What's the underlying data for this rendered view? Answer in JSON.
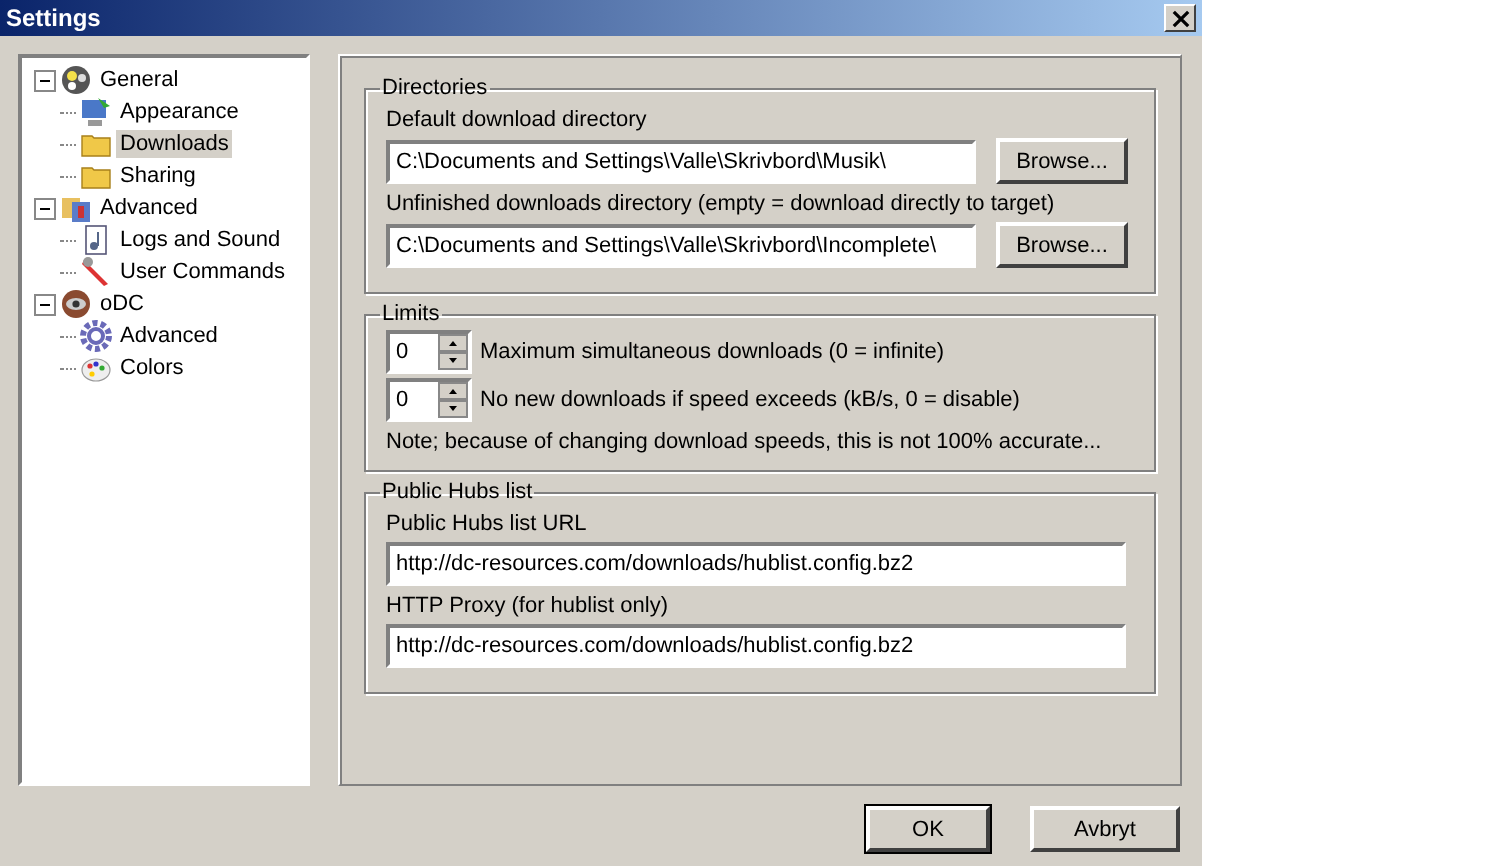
{
  "window": {
    "title": "Settings"
  },
  "tree": [
    {
      "label": "General",
      "expanded": true,
      "selected": false,
      "children": [
        {
          "label": "Appearance",
          "selected": false
        },
        {
          "label": "Downloads",
          "selected": true
        },
        {
          "label": "Sharing",
          "selected": false
        }
      ]
    },
    {
      "label": "Advanced",
      "expanded": true,
      "selected": false,
      "children": [
        {
          "label": "Logs and Sound",
          "selected": false
        },
        {
          "label": "User Commands",
          "selected": false
        }
      ]
    },
    {
      "label": "oDC",
      "expanded": true,
      "selected": false,
      "children": [
        {
          "label": "Advanced",
          "selected": false
        },
        {
          "label": "Colors",
          "selected": false
        }
      ]
    }
  ],
  "directories": {
    "title": "Directories",
    "fields": [
      {
        "label": "Default download directory",
        "value": "C:\\Documents and Settings\\Valle\\Skrivbord\\Musik\\",
        "button": "Browse..."
      },
      {
        "label": "Unfinished downloads directory (empty = download directly to target)",
        "value": "C:\\Documents and Settings\\Valle\\Skrivbord\\Incomplete\\",
        "button": "Browse..."
      }
    ]
  },
  "limits": {
    "title": "Limits",
    "spinners": [
      {
        "value": "0",
        "label": "Maximum simultaneous downloads (0 = infinite)"
      },
      {
        "value": "0",
        "label": "No new downloads if speed exceeds (kB/s, 0 = disable)"
      }
    ],
    "note": "Note; because of changing download speeds, this is not 100% accurate..."
  },
  "hubs": {
    "title": "Public Hubs list",
    "fields": [
      {
        "label": "Public Hubs list URL",
        "value": "http://dc-resources.com/downloads/hublist.config.bz2"
      },
      {
        "label": "HTTP Proxy (for hublist only)",
        "value": "http://dc-resources.com/downloads/hublist.config.bz2"
      }
    ]
  },
  "buttons": [
    "OK",
    "Avbryt"
  ]
}
